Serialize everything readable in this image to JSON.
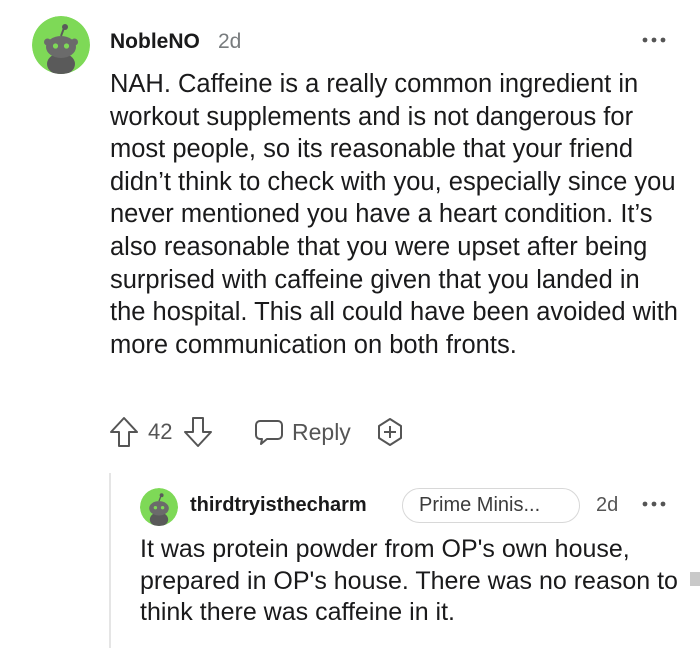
{
  "comment": {
    "username": "NobleNO",
    "time": "2d",
    "body": "NAH. Caffeine is a really common ingredient in workout supplements and is not dangerous for most people, so its reasonable that your friend didn’t think to check with you, especially since you never mentioned you have a heart condition. It’s also reasonable that you were upset after being surprised with caffeine given that you landed in the hospital. This all could have been avoided with more communication on both fronts.",
    "vote_count": "42",
    "reply_label": "Reply"
  },
  "reply": {
    "username": "thirdtryisthecharm",
    "flair": "Prime Minis...",
    "time": "2d",
    "body": "It was protein powder from OP's own house, prepared in OP's house. There was no reason to think there was caffeine in it."
  },
  "icons": {
    "more": "more-horizontal-icon",
    "upvote": "upvote-arrow-icon",
    "downvote": "downvote-arrow-icon",
    "reply": "speech-bubble-icon",
    "award": "award-plus-icon",
    "avatar": "snoo-avatar-icon"
  },
  "colors": {
    "avatar_bg": "#7ed957",
    "text": "#1a1a1b",
    "muted": "#787c7e"
  }
}
